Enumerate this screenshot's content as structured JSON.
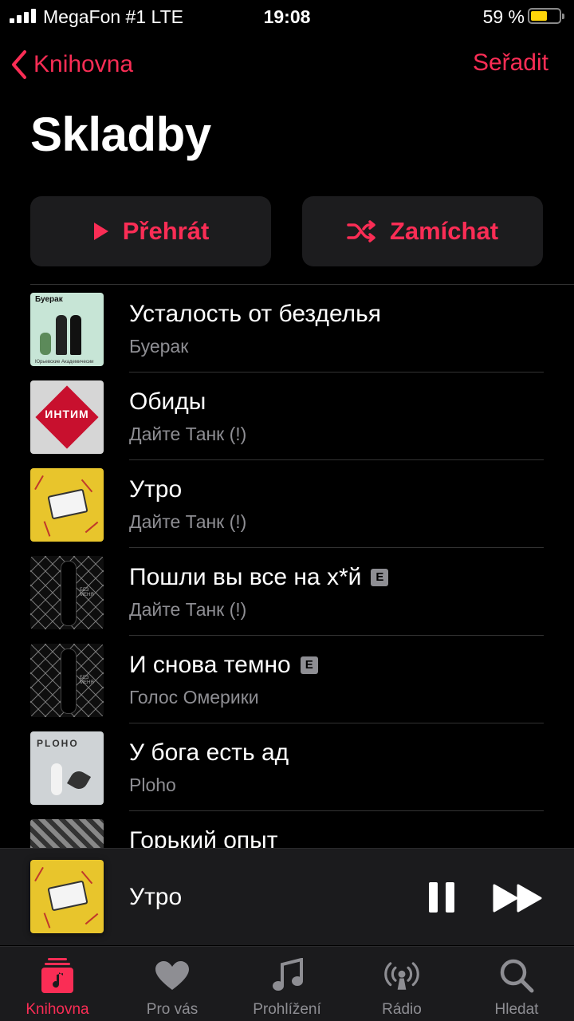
{
  "status": {
    "carrier": "MegaFon #1  LTE",
    "time": "19:08",
    "battery": "59 %",
    "battery_level": 0.59
  },
  "nav": {
    "back_label": "Knihovna",
    "sort_label": "Seřadit"
  },
  "page": {
    "title": "Skladby"
  },
  "actions": {
    "play_label": "Přehrát",
    "shuffle_label": "Zamíchat"
  },
  "songs": [
    {
      "title": "Усталость от безделья",
      "artist": "Буерак",
      "explicit": false,
      "art_text": "Буерак",
      "art_subtext": "Юрьевские Академичесии"
    },
    {
      "title": "Обиды",
      "artist": "Дайте Танк (!)",
      "explicit": false,
      "art_text": "ИНТИМ"
    },
    {
      "title": "Утро",
      "artist": "Дайте Танк (!)",
      "explicit": false
    },
    {
      "title": "Пошли вы все на х*й",
      "artist": "Дайте Танк (!)",
      "explicit": true,
      "art_text": "БЕЗ МЕНЯ"
    },
    {
      "title": "И снова темно",
      "artist": "Голос Омерики",
      "explicit": true,
      "art_text": "БЕЗ МЕНЯ"
    },
    {
      "title": "У бога есть ад",
      "artist": "Ploho",
      "explicit": false,
      "art_text": "PLOHO"
    },
    {
      "title": "Горький опыт",
      "artist": "",
      "explicit": false
    }
  ],
  "explicit_badge": "E",
  "now_playing": {
    "title": "Утро"
  },
  "tabs": [
    {
      "label": "Knihovna",
      "icon": "library-icon",
      "active": true
    },
    {
      "label": "Pro vás",
      "icon": "heart-icon",
      "active": false
    },
    {
      "label": "Prohlížení",
      "icon": "music-note-icon",
      "active": false
    },
    {
      "label": "Rádio",
      "icon": "radio-icon",
      "active": false
    },
    {
      "label": "Hledat",
      "icon": "search-icon",
      "active": false
    }
  ],
  "colors": {
    "accent": "#fa2d55",
    "background": "#000000",
    "secondary_text": "#8e8e93",
    "battery": "#ffd60a"
  }
}
